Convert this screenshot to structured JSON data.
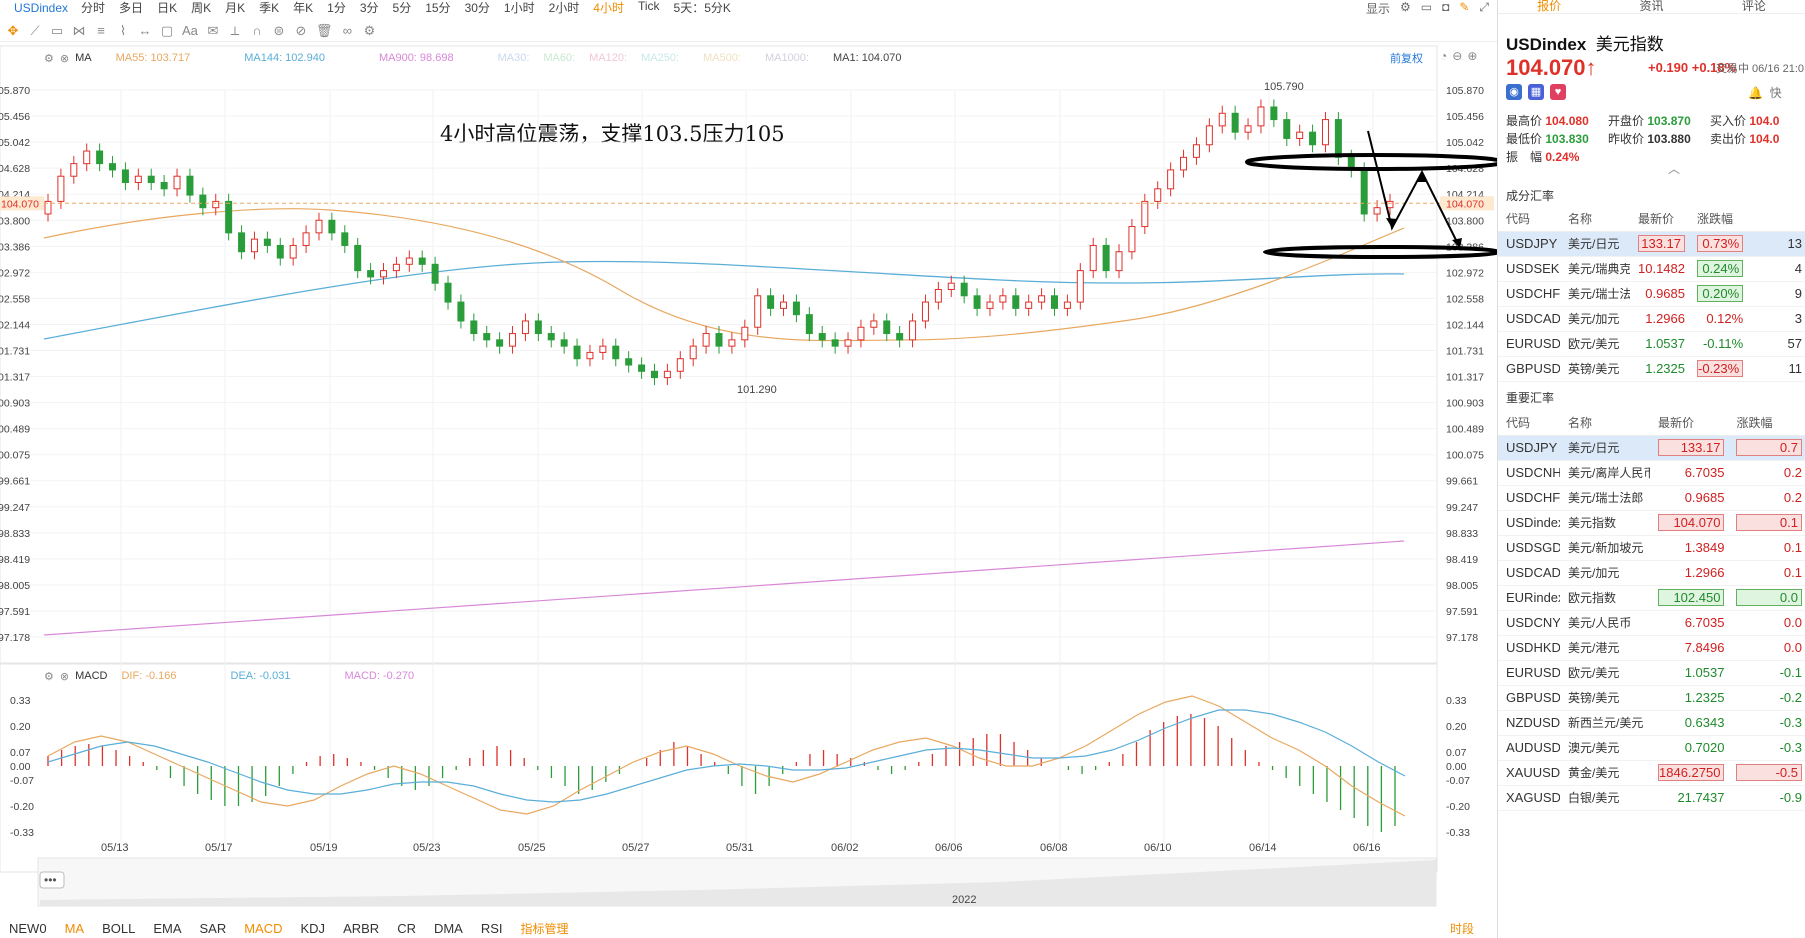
{
  "toolbar": {
    "symbol": "USDindex",
    "timeframes": [
      "分时",
      "多日",
      "日K",
      "周K",
      "月K",
      "季K",
      "年K",
      "1分",
      "3分",
      "5分",
      "15分",
      "30分",
      "1小时",
      "2小时",
      "4小时",
      "Tick",
      "5天：5分K"
    ],
    "active_timeframe": "4小时",
    "display_label": "显示"
  },
  "legend": {
    "ma_label": "MA",
    "ma55": "MA55: 103.717",
    "ma144": "MA144: 102.940",
    "ma900": "MA900: 98.698",
    "ma30": "MA30:",
    "ma60": "MA60:",
    "ma120": "MA120:",
    "ma250": "MA250:",
    "ma500": "MA500:",
    "ma1000": "MA1000:",
    "ma1": "MA1: 104.070",
    "fq": "前复权",
    "macd_label": "MACD",
    "dif": "DIF: -0.166",
    "dea": "DEA: -0.031",
    "macd": "MACD: -0.270"
  },
  "annotation": "4小时高位震荡，支撑103.5压力105",
  "price_axis": [
    "105.870",
    "105.456",
    "105.042",
    "104.628",
    "104.214",
    "103.800",
    "103.386",
    "102.972",
    "102.558",
    "102.144",
    "101.731",
    "101.317",
    "100.903",
    "100.489",
    "100.075",
    "99.661",
    "99.247",
    "98.833",
    "98.419",
    "98.005",
    "97.591",
    "97.178"
  ],
  "current_price_tag": "104.070",
  "high_label": "105.790",
  "low_label": "101.290",
  "macd_axis": [
    "0.33",
    "0.20",
    "0.07",
    "0.00",
    "-0.07",
    "-0.20",
    "-0.33"
  ],
  "dates": [
    "05/13",
    "05/17",
    "05/19",
    "05/23",
    "05/25",
    "05/27",
    "05/31",
    "06/02",
    "06/06",
    "06/08",
    "06/10",
    "06/14",
    "06/16"
  ],
  "year_label": "2022",
  "indicators": [
    "NEW0",
    "MA",
    "BOLL",
    "EMA",
    "SAR",
    "MACD",
    "KDJ",
    "ARBR",
    "CR",
    "DMA",
    "RSI"
  ],
  "active_indicators": [
    "MA",
    "MACD"
  ],
  "indicator_manager": "指标管理",
  "time_share_label": "时段",
  "colors": {
    "up": "#e0302a",
    "down": "#2a9d3a",
    "ma55": "#e8a860",
    "ma144": "#5aaed8",
    "ma900": "#d888d8"
  },
  "panel": {
    "tabs": [
      "报价",
      "资讯",
      "评论"
    ],
    "active_tab": "报价",
    "code": "USDindex",
    "name": "美元指数",
    "price": "104.070",
    "arrow": "↑",
    "change": "+0.190",
    "change_pct": "+0.18%",
    "trade_time": "交易中 06/16 21:0",
    "quick": "快",
    "stats": {
      "high_label": "最高价",
      "high": "104.080",
      "open_label": "开盘价",
      "open": "103.870",
      "buy_label": "买入价",
      "buy": "104.0",
      "low_label": "最低价",
      "low": "103.830",
      "prev_label": "昨收价",
      "prev": "103.880",
      "sell_label": "卖出价",
      "sell": "104.0",
      "amp_label": "振　幅",
      "amp": "0.24%"
    },
    "section1_title": "成分汇率",
    "section1_headers": [
      "代码",
      "名称",
      "最新价",
      "涨跌幅"
    ],
    "section1_rows": [
      {
        "code": "USDJPY",
        "name": "美元/日元",
        "price": "133.17",
        "pct": "0.73%",
        "extra": "13",
        "style": "boxred"
      },
      {
        "code": "USDSEK",
        "name": "美元/瑞典克",
        "price": "10.1482",
        "pct": "0.24%",
        "extra": "4",
        "style": "red-boxgreen"
      },
      {
        "code": "USDCHF",
        "name": "美元/瑞士法",
        "price": "0.9685",
        "pct": "0.20%",
        "extra": "9",
        "style": "red-boxgreen"
      },
      {
        "code": "USDCAD",
        "name": "美元/加元",
        "price": "1.2966",
        "pct": "0.12%",
        "extra": "3",
        "style": "red"
      },
      {
        "code": "EURUSD",
        "name": "欧元/美元",
        "price": "1.0537",
        "pct": "-0.11%",
        "extra": "57",
        "style": "green"
      },
      {
        "code": "GBPUSD",
        "name": "英镑/美元",
        "price": "1.2325",
        "pct": "-0.23%",
        "extra": "11",
        "style": "green-boxred"
      }
    ],
    "section2_title": "重要汇率",
    "section2_headers": [
      "代码",
      "名称",
      "最新价",
      "涨跌幅"
    ],
    "section2_rows": [
      {
        "code": "USDJPY",
        "name": "美元/日元",
        "price": "133.17",
        "pct": "0.7",
        "style": "boxred",
        "sel": true
      },
      {
        "code": "USDCNH",
        "name": "美元/离岸人民币",
        "price": "6.7035",
        "pct": "0.2",
        "style": "red"
      },
      {
        "code": "USDCHF",
        "name": "美元/瑞士法郎",
        "price": "0.9685",
        "pct": "0.2",
        "style": "red"
      },
      {
        "code": "USDindex",
        "name": "美元指数",
        "price": "104.070",
        "pct": "0.1",
        "style": "boxred"
      },
      {
        "code": "USDSGD",
        "name": "美元/新加坡元",
        "price": "1.3849",
        "pct": "0.1",
        "style": "red"
      },
      {
        "code": "USDCAD",
        "name": "美元/加元",
        "price": "1.2966",
        "pct": "0.1",
        "style": "red"
      },
      {
        "code": "EURindex",
        "name": "欧元指数",
        "price": "102.450",
        "pct": "0.0",
        "style": "boxgreen"
      },
      {
        "code": "USDCNY",
        "name": "美元/人民币",
        "price": "6.7035",
        "pct": "0.0",
        "style": "red"
      },
      {
        "code": "USDHKD",
        "name": "美元/港元",
        "price": "7.8496",
        "pct": "0.0",
        "style": "red"
      },
      {
        "code": "EURUSD",
        "name": "欧元/美元",
        "price": "1.0537",
        "pct": "-0.1",
        "style": "green"
      },
      {
        "code": "GBPUSD",
        "name": "英镑/美元",
        "price": "1.2325",
        "pct": "-0.2",
        "style": "green"
      },
      {
        "code": "NZDUSD",
        "name": "新西兰元/美元",
        "price": "0.6343",
        "pct": "-0.3",
        "style": "green"
      },
      {
        "code": "AUDUSD",
        "name": "澳元/美元",
        "price": "0.7020",
        "pct": "-0.3",
        "style": "green"
      },
      {
        "code": "XAUUSD",
        "name": "黄金/美元",
        "price": "1846.2750",
        "pct": "-0.5",
        "style": "boxred"
      },
      {
        "code": "XAGUSD",
        "name": "白银/美元",
        "price": "21.7437",
        "pct": "-0.9",
        "style": "green"
      }
    ]
  }
}
